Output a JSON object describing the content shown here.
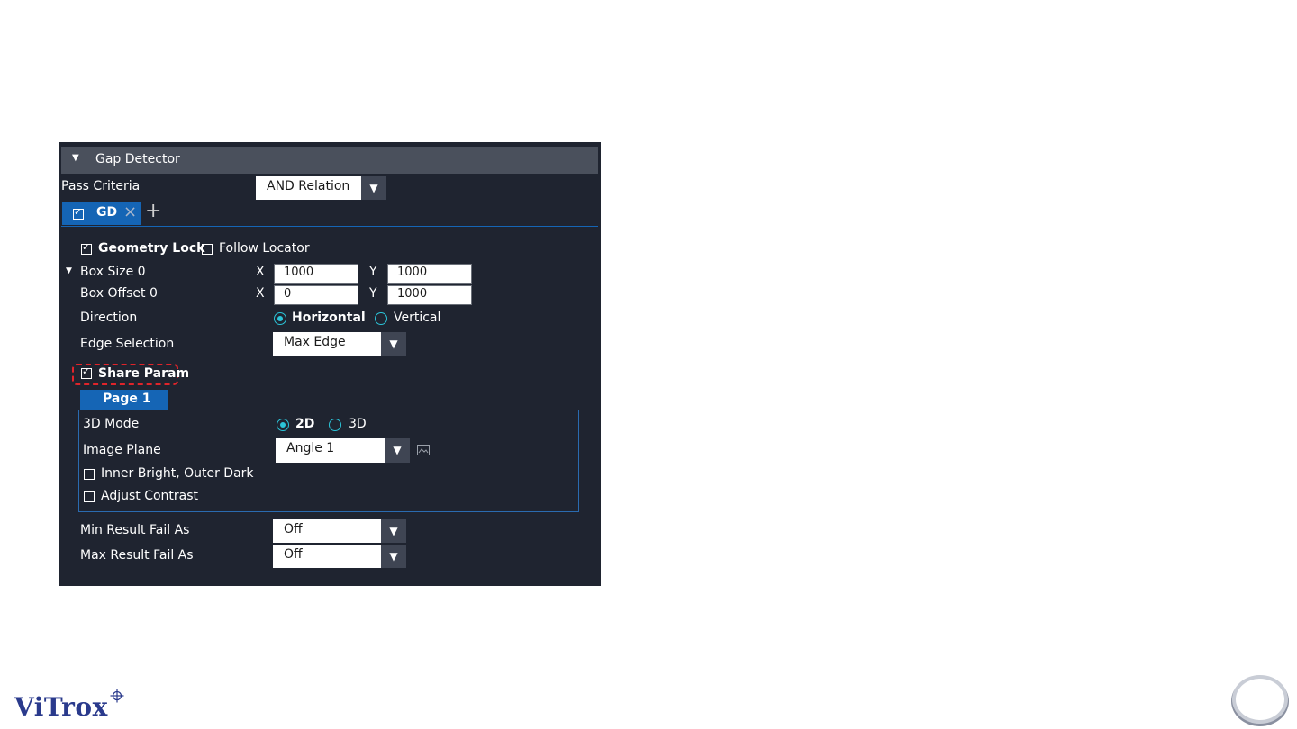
{
  "panel": {
    "section_title": "Gap Detector",
    "pass_criteria_label": "Pass Criteria",
    "pass_criteria_value": "AND Relation",
    "tab_label": "GD",
    "geometry_lock_label": "Geometry Lock",
    "geometry_lock_checked": true,
    "follow_locator_label": "Follow Locator",
    "follow_locator_checked": false,
    "box_size_label": "Box Size 0",
    "box_size_x_label": "X",
    "box_size_x": "1000",
    "box_size_y_label": "Y",
    "box_size_y": "1000",
    "box_offset_label": "Box Offset 0",
    "box_offset_x_label": "X",
    "box_offset_x": "0",
    "box_offset_y_label": "Y",
    "box_offset_y": "1000",
    "direction_label": "Direction",
    "direction_options": [
      "Horizontal",
      "Vertical"
    ],
    "direction_selected": "Horizontal",
    "edge_selection_label": "Edge Selection",
    "edge_selection_value": "Max Edge",
    "share_param_label": "Share Param",
    "share_param_checked": true,
    "page_tab_label": "Page 1",
    "mode_label": "3D Mode",
    "mode_options": [
      "2D",
      "3D"
    ],
    "mode_selected": "2D",
    "image_plane_label": "Image Plane",
    "image_plane_value": "Angle 1",
    "inner_bright_label": "Inner Bright, Outer Dark",
    "inner_bright_checked": false,
    "adjust_contrast_label": "Adjust Contrast",
    "adjust_contrast_checked": false,
    "min_result_label": "Min Result Fail As",
    "min_result_value": "Off",
    "max_result_label": "Max Result Fail As",
    "max_result_value": "Off"
  },
  "logo": {
    "text": "ViTrox"
  },
  "colors": {
    "panel_bg": "#1f2430",
    "header_bg": "#4a505c",
    "accent_blue": "#1565b5",
    "radio_teal": "#2bc4d8",
    "highlight_red": "#e0242a"
  }
}
